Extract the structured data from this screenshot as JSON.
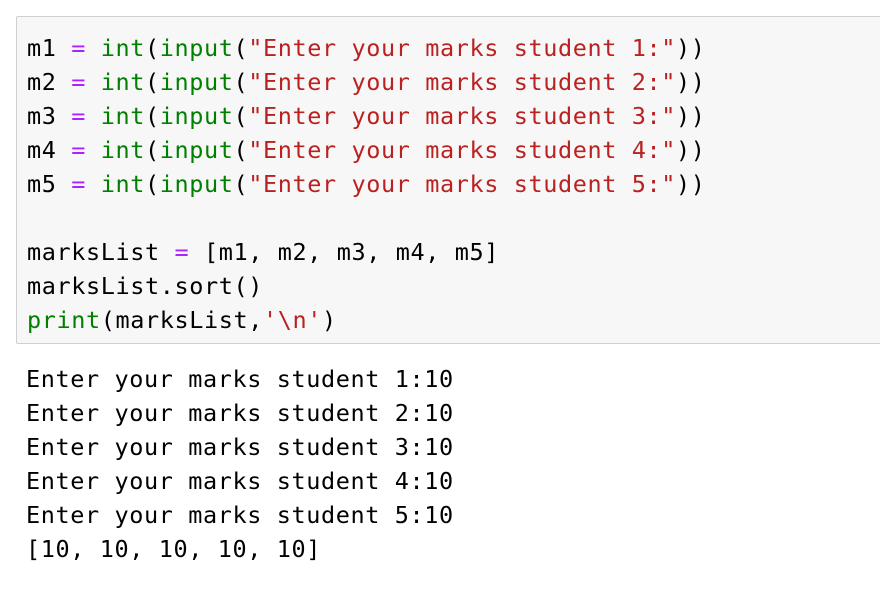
{
  "code_cell": {
    "input_lines": [
      {
        "var": "m1",
        "eq": "=",
        "fn1": "int",
        "p1": "(",
        "fn2": "input",
        "p2": "(",
        "str": "\"Enter your marks student 1:\"",
        "close": "))"
      },
      {
        "var": "m2",
        "eq": "=",
        "fn1": "int",
        "p1": "(",
        "fn2": "input",
        "p2": "(",
        "str": "\"Enter your marks student 2:\"",
        "close": "))"
      },
      {
        "var": "m3",
        "eq": "=",
        "fn1": "int",
        "p1": "(",
        "fn2": "input",
        "p2": "(",
        "str": "\"Enter your marks student 3:\"",
        "close": "))"
      },
      {
        "var": "m4",
        "eq": "=",
        "fn1": "int",
        "p1": "(",
        "fn2": "input",
        "p2": "(",
        "str": "\"Enter your marks student 4:\"",
        "close": "))"
      },
      {
        "var": "m5",
        "eq": "=",
        "fn1": "int",
        "p1": "(",
        "fn2": "input",
        "p2": "(",
        "str": "\"Enter your marks student 5:\"",
        "close": "))"
      }
    ],
    "list_line": {
      "var": "marksList",
      "eq": "=",
      "value": "[m1, m2, m3, m4, m5]"
    },
    "sort_line": "marksList.sort()",
    "print_line": {
      "fn": "print",
      "open": "(marksList,",
      "str": "'\\n'",
      "close": ")"
    }
  },
  "output": {
    "lines": [
      "Enter your marks student 1:10",
      "Enter your marks student 2:10",
      "Enter your marks student 3:10",
      "Enter your marks student 4:10",
      "Enter your marks student 5:10",
      "[10, 10, 10, 10, 10]"
    ]
  },
  "colors": {
    "builtin": "#008000",
    "operator": "#aa22ff",
    "string": "#ba2121",
    "cell_background": "#f7f7f7",
    "cell_border": "#cfcfcf"
  }
}
